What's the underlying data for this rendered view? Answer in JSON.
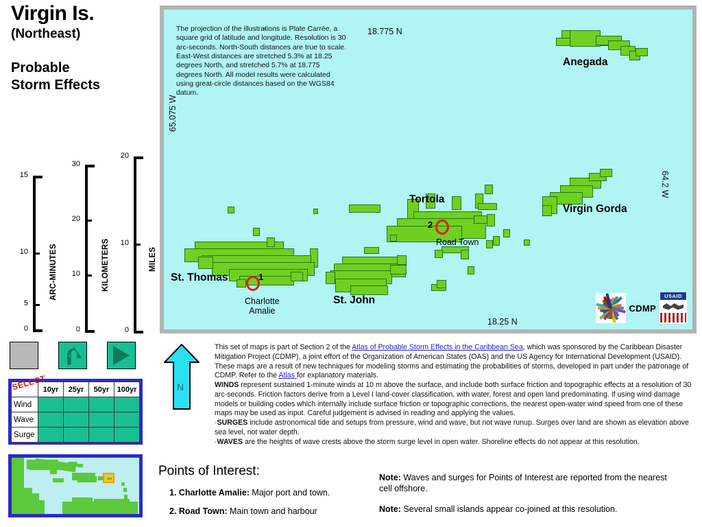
{
  "title": {
    "main": "Virgin Is.",
    "sub": "(Northeast)",
    "subject": "Probable\nStorm Effects"
  },
  "map": {
    "projection_note": "The projection of the illustrations is Plate Carrée, a square grid of latitude and longitude. Resolution is 30 arc-seconds. North-South distances are true to scale. East-West distances are stretched 5.3% at 18.25 degrees North, and stretched 5.7% at 18.775 degrees North.  All model results were calculated using great-circle distances based on the WGS84 datum.",
    "coords": {
      "north_top": "18.775 N",
      "north_bottom": "18.25 N",
      "west_left": "65.075 W",
      "west_right": "64.2 W"
    },
    "islands": [
      {
        "name": "Anegada"
      },
      {
        "name": "Tortola"
      },
      {
        "name": "Virgin Gorda"
      },
      {
        "name": "St. Thomas"
      },
      {
        "name": "St. John"
      }
    ],
    "towns": [
      {
        "num": "1",
        "name": "Charlotte\nAmalie"
      },
      {
        "num": "2",
        "name": "Road Town"
      }
    ],
    "logos": {
      "cdmp": "CDMP",
      "usaid": "USAID"
    },
    "colors": {
      "sea": "#b0f4f4",
      "land": "#6ed020",
      "land_border": "#1f7a17",
      "poi_ring": "#e21b1b"
    }
  },
  "scales": [
    {
      "name": "ARC-MINUTES",
      "ticks": [
        "0",
        "5",
        "10",
        "15"
      ],
      "max": 15
    },
    {
      "name": "KILOMETERS",
      "ticks": [
        "0",
        "10",
        "20",
        "30"
      ],
      "max": 30
    },
    {
      "name": "MILES",
      "ticks": [
        "0",
        "10",
        "20"
      ],
      "max": 20
    }
  ],
  "buttons": [
    {
      "name": "blank-button",
      "label": ""
    },
    {
      "name": "back-button",
      "label": ""
    },
    {
      "name": "play-button",
      "label": ""
    }
  ],
  "select_table": {
    "corner_label": "SELECT",
    "columns": [
      "10yr",
      "25yr",
      "50yr",
      "100yr"
    ],
    "rows": [
      "Wind",
      "Wave",
      "Surge"
    ]
  },
  "north_arrow": {
    "label": "N"
  },
  "description": {
    "para1_a": "This set of maps is part of Section 2 of the ",
    "para1_link": "Atlas of Probable Storm Effects in the Caribbean Sea",
    "para1_b": ", which was sponsored by the Caribbean Disaster Mitigation Project (CDMP), a joint effort of the Organization of American States (OAS) and the US Agency for International Development (USAID). These maps are a result of new  techniques for modeling storms and estimating the probabilities of storms, developed in part under the patronage of CDMP.  Refer to the ",
    "para1_link2": "Atlas ",
    "para1_c": "for explanatory materials.",
    "winds_label": "WINDS",
    "winds_text": " represent sustained 1-minute winds at 10 m above the surface, and include both surface friction and topographic effects at a resolution of 30 arc-seconds.  Friction factors derive from a Level I land-cover classification, with water, forest and open land predominating.  If using wind damage models or building codes which internally include surface friction or topographic corrections, the nearest open-water wind speed from one of these maps may be used as input.  Careful judgement is advised in reading and applying the values.",
    "surges_bullet": "·",
    "surges_label": "SURGES",
    "surges_text": " include astronomical tide and setups from pressure, wind and wave, but not wave runup.  Surges over land are shown as elevation above sea level, not water depth.",
    "waves_bullet": "·",
    "waves_label": "WAVES",
    "waves_text": " are the heights of wave crests above the storm surge level in open water.  Shoreline effects do not appear at this resolution."
  },
  "points_of_interest": {
    "heading": "Points of Interest:",
    "items": [
      {
        "num": "1. ",
        "name": "Charlotte Amalie:",
        "desc": "  Major port and town."
      },
      {
        "num": "2. ",
        "name": "Road Town:",
        "desc": "  Main town and harbour"
      }
    ]
  },
  "notes": [
    {
      "label": "Note:",
      "text": "  Waves and surges for Points of Interest are reported from the nearest cell offshore."
    },
    {
      "label": "Note:",
      "text": "  Several small islands appear co-joined at this resolution."
    }
  ]
}
